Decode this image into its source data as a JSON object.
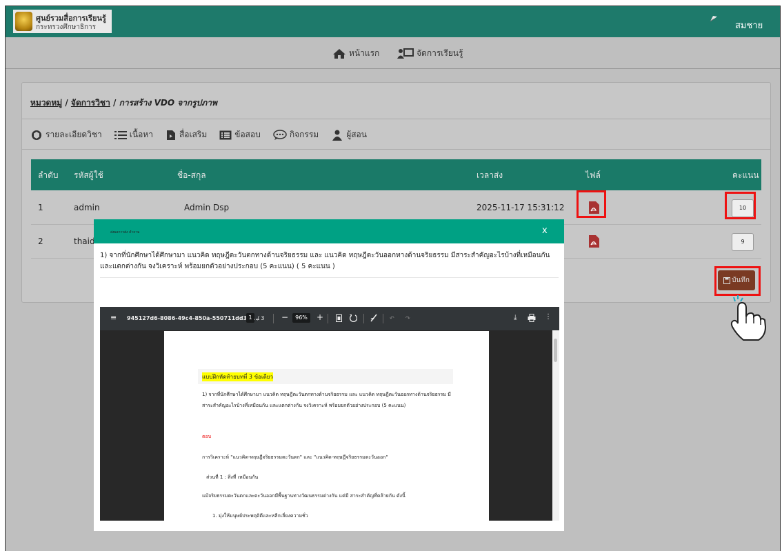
{
  "header": {
    "site_title": "ศูนย์รวมสื่อการเรียนรู้",
    "site_subtitle": "กระทรวงศึกษาธิการ",
    "username": "สมชาย"
  },
  "nav": {
    "home": "หน้าแรก",
    "manage": "จัดการเรียนรู้"
  },
  "breadcrumb": {
    "category": "หมวดหมู่",
    "sep1": " / ",
    "manage": "จัดการวิชา",
    "sep2": " / ",
    "current": "การสร้าง VDO จากรูปภาพ"
  },
  "tabs": [
    "รายละเอียดวิชา",
    "เนื้อหา",
    "สื่อเสริม",
    "ข้อสอบ",
    "กิจกรรม",
    "ผู้สอน"
  ],
  "table": {
    "headers": [
      "ลำดับ",
      "รหัสผู้ใช้",
      "ชื่อ-สกุล",
      "เวลาส่ง",
      "ไฟล์",
      "คะแนน"
    ],
    "rows": [
      {
        "no": "1",
        "user": "admin",
        "name": "Admin Dsp",
        "time": "2025-11-17 15:31:12",
        "score": "10"
      },
      {
        "no": "2",
        "user": "thaid",
        "name": "",
        "time": "",
        "score": "9"
      }
    ]
  },
  "save_label": "บันทึก",
  "modal": {
    "title": "ส่งผลการส่ง คำถาม",
    "close": "x",
    "question": "1) จากที่นักศึกษาได้ศึกษามา แนวคิด ทฤษฎีตะวันตกทางด้านจริยธรรม และ แนวคิด ทฤษฎีตะวันออกทางด้านจริยธรรม มีสาระสำคัญอะไรบ้างที่เหมือนกัน และแตกต่างกัน จงวิเคราะห์ พร้อมยกตัวอย่างประกอบ (5 คะแนน) ( 5 คะแนน )"
  },
  "viewer": {
    "filename": "945127d6-8086-49c4-850a-550711dd3fd...",
    "page": "1",
    "page_total": "/ 3",
    "zoom": "96%"
  },
  "document": {
    "heading": "แบบฝึกหัดท้ายบทที่ 3 ข้อเดียว",
    "question": "1) จากที่นักศึกษาได้ศึกษามา แนวคิด ทฤษฎีตะวันตกทางด้านจริยธรรม และ แนวคิด ทฤษฎีตะวันออกทางด้านจริยธรรม มีสาระสำคัญอะไรบ้างที่เหมือนกัน และแตกต่างกัน จงวิเคราะห์ พร้อมยกตัวอย่างประกอบ (5 คะแนน)",
    "answer_label": "ตอบ",
    "line1": "การวิเคราะห์ \"แนวคิด-ทฤษฎีจริยธรรมตะวันตก\" และ \"แนวคิด-ทฤษฎีจริยธรรมตะวันออก\"",
    "line2": "ส่วนที่ 1 : สิ่งที่ เหมือนกัน",
    "line3": "แม้จริยธรรมตะวันตกและตะวันออกมีพื้นฐานทางวัฒนธรรมต่างกัน แต่มี สาระสำคัญที่คล้ายกัน ดังนี้",
    "line4": "1.  มุ่งให้มนุษย์ประพฤติดีและหลีกเลี่ยงความชั่ว"
  },
  "colors": {
    "header_green": "#1e7a6b",
    "modal_green": "#00a184",
    "highlight_red": "#ee1111",
    "save_brown": "#7a3a23"
  }
}
